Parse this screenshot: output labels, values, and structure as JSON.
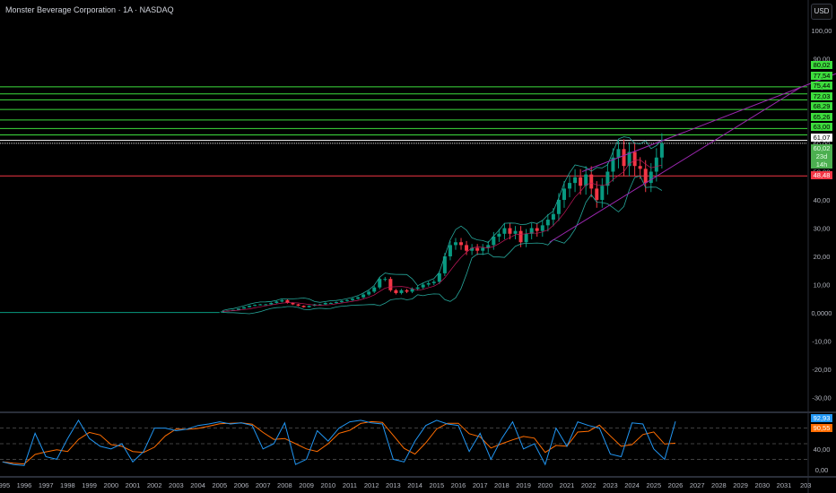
{
  "header": {
    "title": "Monster Beverage Corporation · 1A · NASDAQ",
    "currency_button": "USD"
  },
  "colors": {
    "up": "#089981",
    "down": "#f23645",
    "level_green": "#3ddc3d",
    "level_white": "#ffffff",
    "level_red": "#f23645",
    "trendline": "#9c27b0",
    "bands": "#26a69a",
    "basis": "#c2185b",
    "k_line": "#2196f3",
    "d_line": "#ff6d00"
  },
  "chart_data": [
    {
      "type": "candlestick",
      "title": "Monster Beverage Corporation · 1A · NASDAQ",
      "xlim": [
        1995,
        2032.5
      ],
      "ylim": [
        -35,
        105
      ],
      "y_ticks": [
        "100,00",
        "90,00",
        "80,00",
        "70,00",
        "60,00",
        "50,00",
        "40,00",
        "30,00",
        "20,00",
        "10,00",
        "0,0000",
        "-10,00",
        "-20,00",
        "-30,00"
      ],
      "y_tick_values": [
        100,
        90,
        80,
        70,
        60,
        50,
        40,
        30,
        20,
        10,
        0,
        -10,
        -20,
        -30
      ],
      "x_ticks": [
        "1995",
        "1996",
        "1997",
        "1998",
        "1999",
        "2000",
        "2001",
        "2002",
        "2003",
        "2004",
        "2005",
        "2006",
        "2007",
        "2008",
        "2009",
        "2010",
        "2011",
        "2012",
        "2013",
        "2014",
        "2015",
        "2016",
        "2017",
        "2018",
        "2019",
        "2020",
        "2021",
        "2022",
        "2023",
        "2024",
        "2025",
        "2026",
        "2027",
        "2028",
        "2029",
        "2030",
        "2031",
        "203"
      ],
      "pre_2005_level": 0.1,
      "quarterly_start": 2005,
      "quarterly_closes": [
        0.5,
        0.8,
        1.0,
        1.5,
        2.0,
        2.5,
        2.8,
        3.0,
        3.0,
        3.5,
        4.0,
        4.5,
        3.5,
        3.0,
        2.5,
        2.0,
        2.5,
        3.0,
        3.0,
        3.5,
        3.5,
        3.8,
        4.2,
        4.5,
        5.0,
        5.5,
        6.5,
        7.5,
        9,
        12,
        12,
        8,
        7,
        8,
        7.5,
        8.5,
        9,
        10,
        10.5,
        11,
        14,
        20,
        24,
        25,
        24,
        22,
        23,
        22,
        23,
        24,
        27,
        28,
        30,
        28,
        29,
        25,
        28,
        30,
        29,
        31,
        33,
        35,
        40,
        44,
        46,
        48,
        45,
        49,
        44,
        40,
        45,
        50,
        55,
        58,
        52,
        57,
        52,
        51,
        46,
        50,
        55,
        60
      ],
      "horizontal_levels": [
        {
          "value": 80.02,
          "label": "80,02",
          "color": "green"
        },
        {
          "value": 77.54,
          "label": "77,54",
          "color": "green"
        },
        {
          "value": 75.44,
          "label": "75,44",
          "color": "green"
        },
        {
          "value": 72.03,
          "label": "72,03",
          "color": "green"
        },
        {
          "value": 68.29,
          "label": "68,29",
          "color": "green"
        },
        {
          "value": 65.26,
          "label": "65,26",
          "color": "green"
        },
        {
          "value": 63.0,
          "label": "63,00",
          "color": "green"
        },
        {
          "value": 61.07,
          "label": "61,07",
          "color": "white"
        },
        {
          "value": 48.48,
          "label": "48,48",
          "color": "red"
        }
      ],
      "last_price": {
        "value": 60.02,
        "label": "60,02",
        "countdown": "23d 14h"
      },
      "trendlines": [
        {
          "from": [
            2021.7,
            50
          ],
          "to": [
            2033.5,
            85
          ]
        },
        {
          "from": [
            2020.2,
            25
          ],
          "to": [
            2031.8,
            80
          ]
        }
      ]
    },
    {
      "type": "line",
      "y_ticks": [
        "40,00",
        "0,00"
      ],
      "y_tick_values": [
        40,
        0
      ],
      "ylim": [
        0,
        100
      ],
      "bands": [
        80,
        50,
        20
      ],
      "x_start": 1995,
      "step_years": 0.5,
      "k_values": [
        15,
        10,
        8,
        70,
        25,
        20,
        60,
        95,
        60,
        45,
        40,
        50,
        15,
        35,
        80,
        80,
        75,
        78,
        85,
        88,
        92,
        88,
        90,
        85,
        40,
        50,
        90,
        10,
        20,
        75,
        55,
        80,
        92,
        95,
        90,
        88,
        20,
        15,
        55,
        85,
        95,
        88,
        85,
        35,
        70,
        20,
        60,
        92,
        40,
        50,
        10,
        80,
        45,
        92,
        85,
        80,
        30,
        25,
        90,
        88,
        40,
        20,
        92.93
      ],
      "k_label": "92,93",
      "d_label": "90,55"
    }
  ]
}
